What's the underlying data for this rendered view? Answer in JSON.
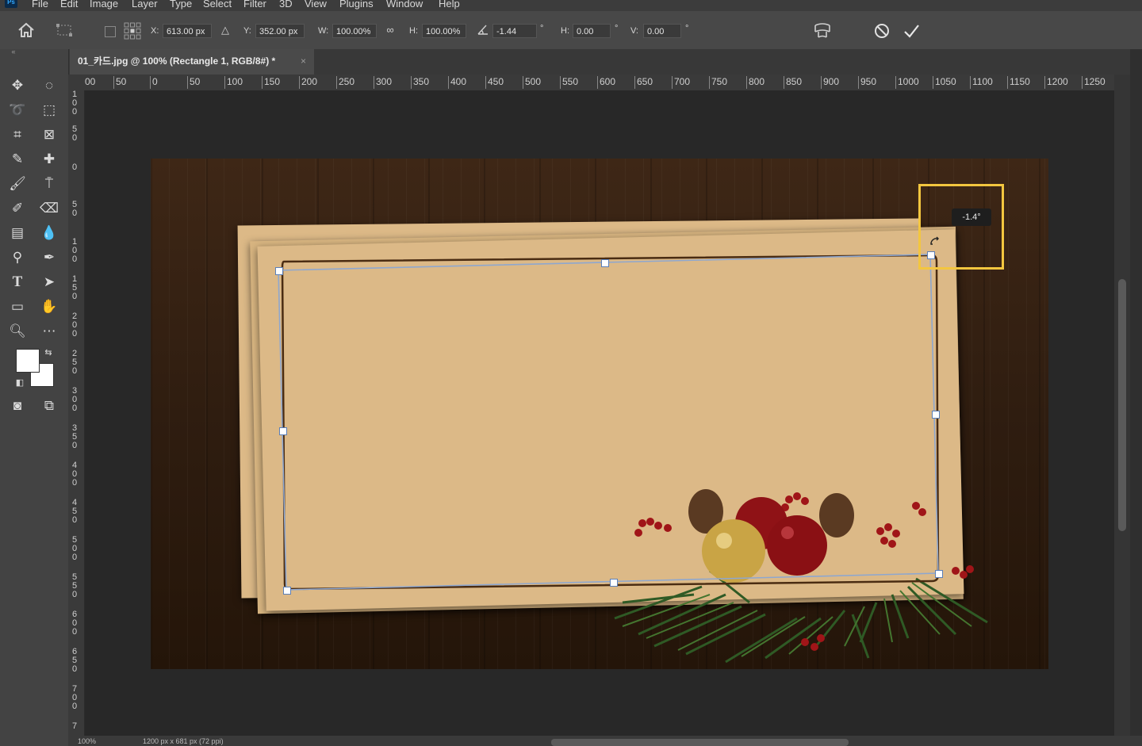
{
  "menu": {
    "app_logo": "Ps",
    "items": [
      "File",
      "Edit",
      "Image",
      "Layer",
      "Type",
      "Select",
      "Filter",
      "3D",
      "View",
      "Plugins",
      "Window",
      "Help"
    ]
  },
  "options_bar": {
    "x_label": "X:",
    "x_value": "613.00 px",
    "y_label": "Y:",
    "y_value": "352.00 px",
    "w_label": "W:",
    "w_value": "100.00%",
    "h_label": "H:",
    "h_value": "100.00%",
    "angle_value": "-1.44",
    "deg_symbol": "°",
    "hskew_label": "H:",
    "hskew_value": "0.00",
    "vskew_label": "V:",
    "vskew_value": "0.00"
  },
  "document_tab": {
    "title": "01_카드.jpg @ 100% (Rectangle 1, RGB/8#) *",
    "close": "×"
  },
  "rulers": {
    "horizontal": [
      "00",
      "50",
      "0",
      "50",
      "100",
      "150",
      "200",
      "250",
      "300",
      "350",
      "400",
      "450",
      "500",
      "550",
      "600",
      "650",
      "700",
      "750",
      "800",
      "850",
      "900",
      "950",
      "1000",
      "1050",
      "1100",
      "1150",
      "1200",
      "1250"
    ],
    "vertical": [
      "100",
      "50",
      "0",
      "50",
      "100",
      "150",
      "200",
      "250",
      "300",
      "350",
      "400",
      "450",
      "500",
      "550",
      "600",
      "650",
      "700",
      "7"
    ]
  },
  "transform": {
    "angle_tooltip": "-1.4°"
  },
  "status": {
    "zoom": "100%",
    "info": "1200 px x 681 px (72 ppi)"
  },
  "colors": {
    "highlight": "#f3c63f",
    "transform_line": "#8ea7cf",
    "paper": "#dcb987"
  }
}
